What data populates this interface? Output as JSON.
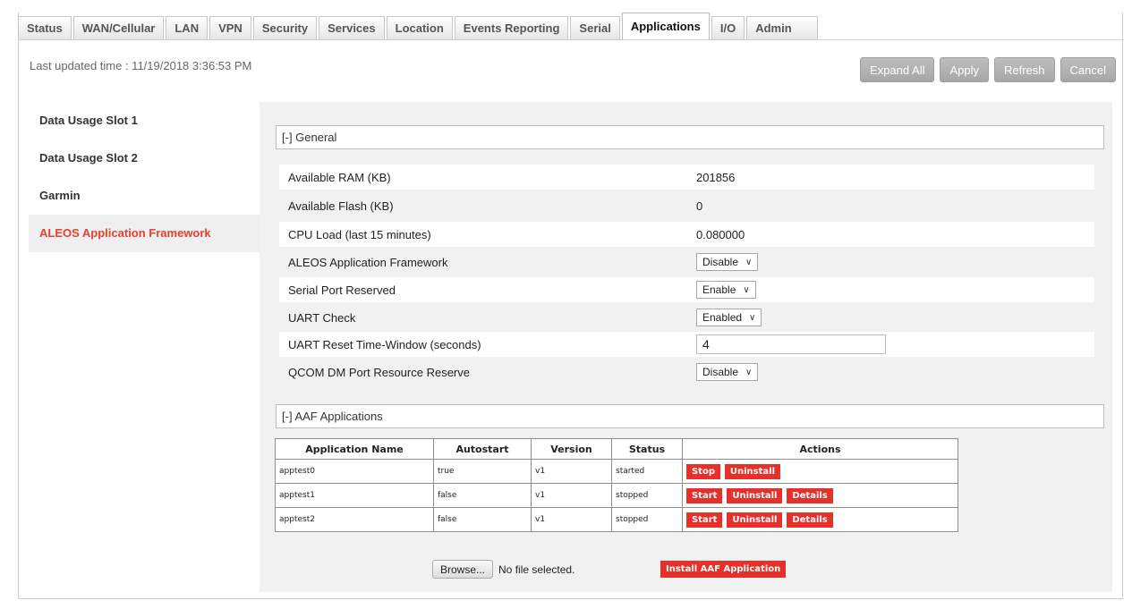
{
  "tabs": [
    "Status",
    "WAN/Cellular",
    "LAN",
    "VPN",
    "Security",
    "Services",
    "Location",
    "Events Reporting",
    "Serial",
    "Applications",
    "I/O",
    "Admin"
  ],
  "active_tab": "Applications",
  "last_updated": "Last updated time : 11/19/2018 3:36:53 PM",
  "toolbar": {
    "expand_all": "Expand All",
    "apply": "Apply",
    "refresh": "Refresh",
    "cancel": "Cancel"
  },
  "sidebar": {
    "items": [
      "Data Usage Slot 1",
      "Data Usage Slot 2",
      "Garmin",
      "ALEOS Application Framework"
    ],
    "active": "ALEOS Application Framework"
  },
  "general": {
    "heading": "[-] General",
    "fields": {
      "ram_label": "Available RAM (KB)",
      "ram_value": "201856",
      "flash_label": "Available Flash (KB)",
      "flash_value": "0",
      "cpu_label": "CPU Load (last 15 minutes)",
      "cpu_value": "0.080000",
      "aaf_label": "ALEOS Application Framework",
      "aaf_value": "Disable",
      "serial_label": "Serial Port Reserved",
      "serial_value": "Enable",
      "uart_label": "UART Check",
      "uart_value": "Enabled",
      "uart_reset_label": "UART Reset Time-Window (seconds)",
      "uart_reset_value": "4",
      "qcom_label": "QCOM DM Port Resource Reserve",
      "qcom_value": "Disable"
    }
  },
  "aaf": {
    "heading": "[-] AAF Applications",
    "columns": [
      "Application Name",
      "Autostart",
      "Version",
      "Status",
      "Actions"
    ],
    "rows": [
      {
        "name": "apptest0",
        "autostart": "true",
        "version": "v1",
        "status": "started",
        "actions": [
          "Stop",
          "Uninstall"
        ]
      },
      {
        "name": "apptest1",
        "autostart": "false",
        "version": "v1",
        "status": "stopped",
        "actions": [
          "Start",
          "Uninstall",
          "Details"
        ]
      },
      {
        "name": "apptest2",
        "autostart": "false",
        "version": "v1",
        "status": "stopped",
        "actions": [
          "Start",
          "Uninstall",
          "Details"
        ]
      }
    ],
    "browse_label": "Browse...",
    "no_file": "No file selected.",
    "install_label": "Install AAF Application"
  },
  "colors": {
    "accent": "#e8302a",
    "sidebar_active_text": "#e8402f",
    "panel_bg": "#f1f1f1"
  }
}
